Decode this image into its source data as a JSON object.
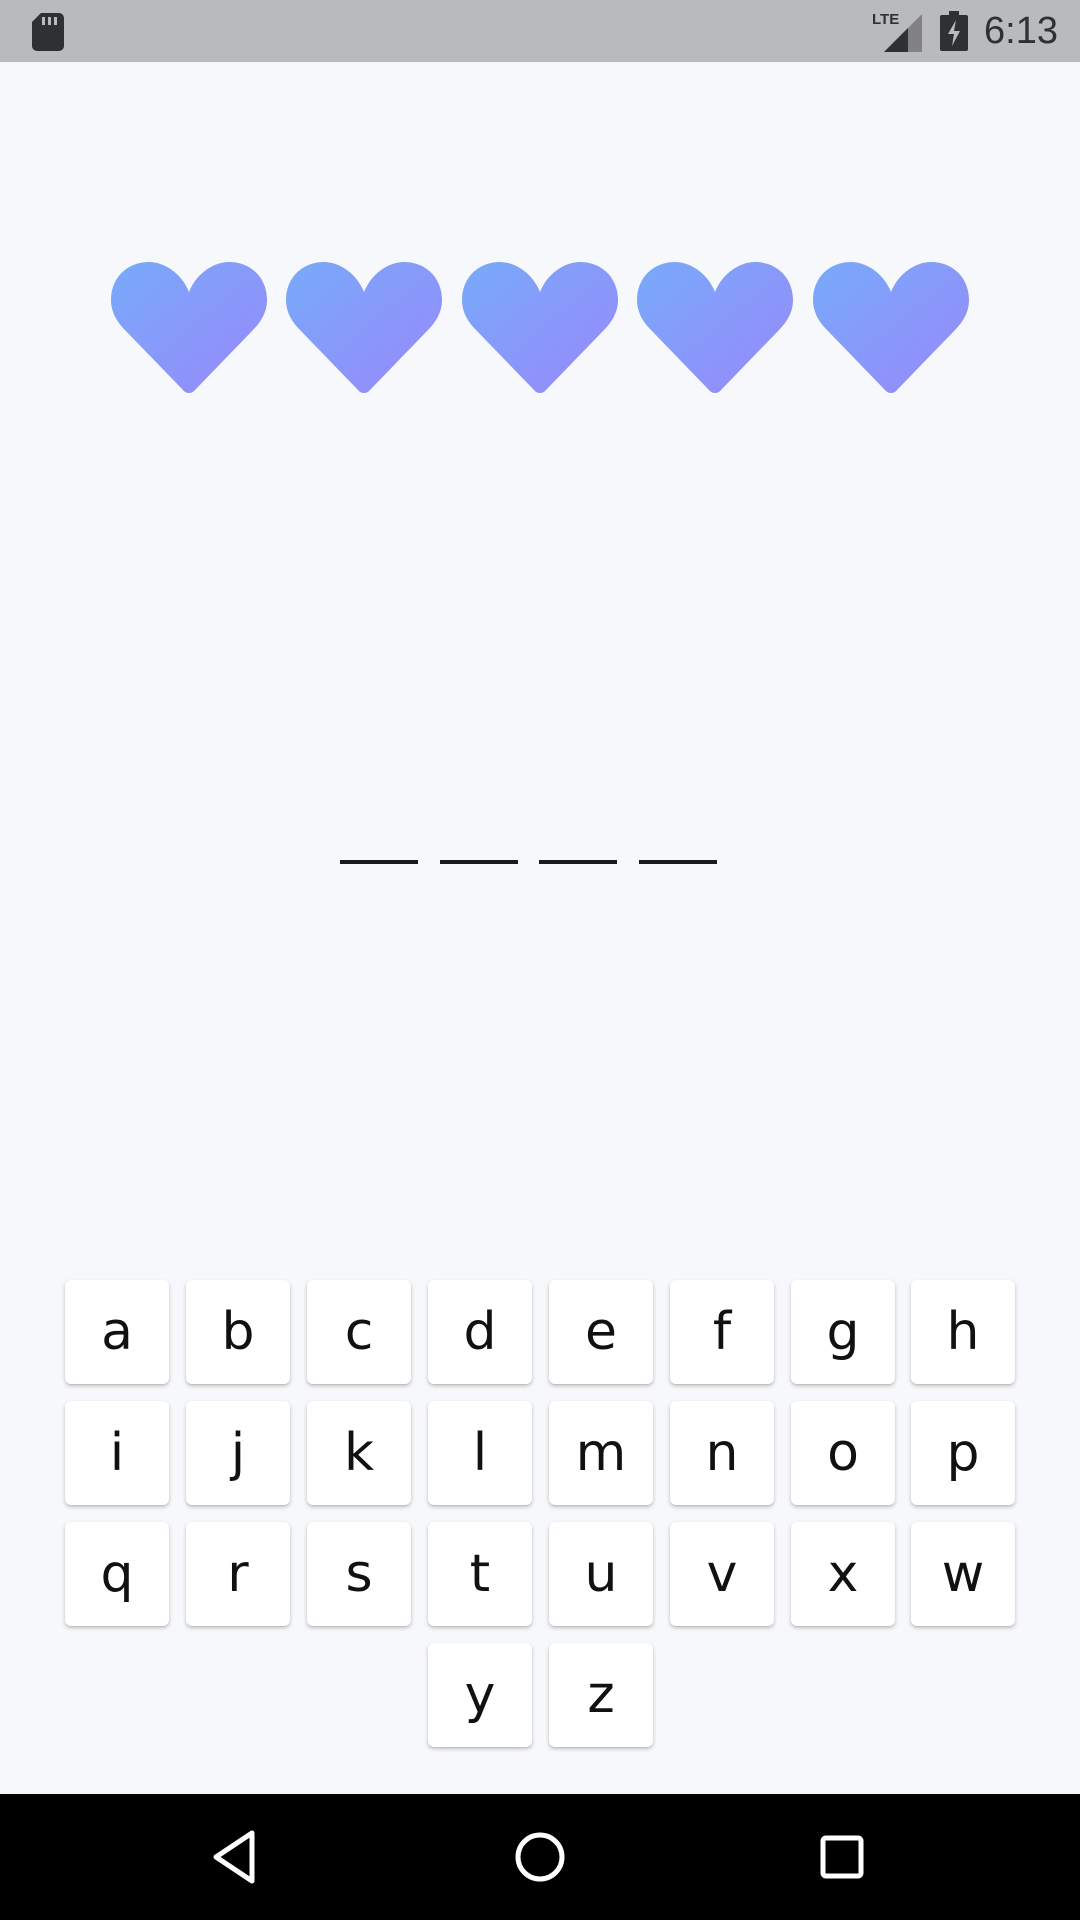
{
  "status_bar": {
    "time": "6:13",
    "network": "LTE",
    "icons": [
      "sd-card-icon",
      "lte-signal-icon",
      "battery-charging-icon"
    ]
  },
  "game": {
    "lives": 5,
    "heart_icon": "heart-icon",
    "heart_gradient": [
      "#78aafa",
      "#9888fa"
    ],
    "word_length": 4,
    "blank_color": "#1a1a1a"
  },
  "keyboard": {
    "rows": [
      [
        "a",
        "b",
        "c",
        "d",
        "e",
        "f",
        "g",
        "h"
      ],
      [
        "i",
        "j",
        "k",
        "l",
        "m",
        "n",
        "o",
        "p"
      ],
      [
        "q",
        "r",
        "s",
        "t",
        "u",
        "v",
        "x",
        "w"
      ],
      [
        "y",
        "z"
      ]
    ]
  },
  "nav_bar": {
    "buttons": [
      "back-icon",
      "home-icon",
      "recents-icon"
    ]
  },
  "colors": {
    "background": "#f7f8fb",
    "status_bar": "#b9babe",
    "nav_bar": "#000000",
    "key": "#ffffff"
  }
}
